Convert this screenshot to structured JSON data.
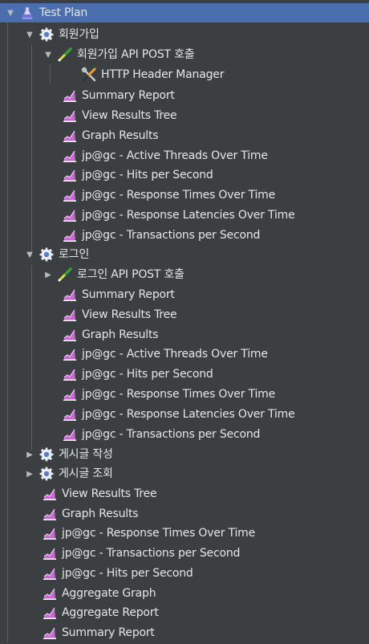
{
  "tree": {
    "root": {
      "label": "Test Plan",
      "icon": "test-plan-icon"
    },
    "groups": [
      {
        "label": "회원가입",
        "icon": "thread-group-gear-icon",
        "sampler": {
          "label": "회원가입 API POST 호출",
          "icon": "sampler-pipette-icon"
        },
        "sampler_children": [
          {
            "label": "HTTP Header Manager",
            "icon": "header-manager-tools-icon"
          }
        ],
        "listeners": [
          "Summary Report",
          "View Results Tree",
          "Graph Results",
          "jp@gc - Active Threads Over Time",
          "jp@gc - Hits per Second",
          "jp@gc - Response Times Over Time",
          "jp@gc - Response Latencies Over Time",
          "jp@gc - Transactions per Second"
        ]
      },
      {
        "label": "로그인",
        "icon": "thread-group-gear-icon",
        "sampler": {
          "label": "로그인 API POST 호출",
          "icon": "sampler-pipette-icon"
        },
        "listeners": [
          "Summary Report",
          "View Results Tree",
          "Graph Results",
          "jp@gc - Active Threads Over Time",
          "jp@gc - Hits per Second",
          "jp@gc - Response Times Over Time",
          "jp@gc - Response Latencies Over Time",
          "jp@gc - Transactions per Second"
        ]
      },
      {
        "label": "게시글 작성",
        "icon": "thread-group-gear-icon"
      },
      {
        "label": "게시글 조회",
        "icon": "thread-group-gear-icon"
      }
    ],
    "root_listeners": [
      "View Results Tree",
      "Graph Results",
      "jp@gc - Response Times Over Time",
      "jp@gc - Transactions per Second",
      "jp@gc - Hits per Second",
      "Aggregate Graph",
      "Aggregate Report",
      "Summary Report"
    ]
  },
  "colors": {
    "background": "#3c3f41",
    "selected": "#4b6eaf",
    "text": "#e6e6e6"
  }
}
